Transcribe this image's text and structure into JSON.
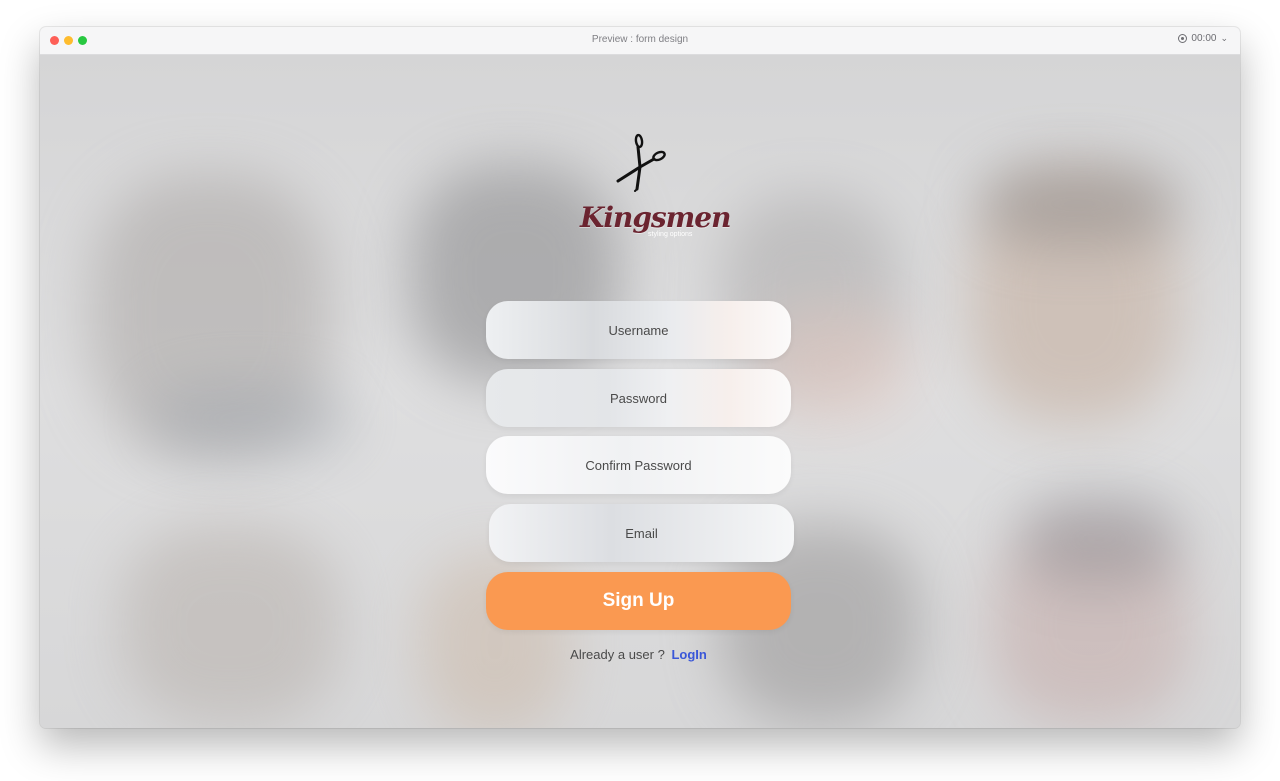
{
  "window": {
    "title": "Preview : form design",
    "timer": "00:00"
  },
  "brand": {
    "name": "Kingsmen",
    "tagline": "styling options",
    "color": "#6b2430"
  },
  "form": {
    "username_placeholder": "Username",
    "password_placeholder": "Password",
    "confirm_password_placeholder": "Confirm Password",
    "email_placeholder": "Email",
    "signup_label": "Sign Up",
    "already_user_text": "Already a user ?",
    "login_label": "LogIn"
  },
  "colors": {
    "accent": "#fa9951",
    "link": "#3a57d8"
  },
  "icons": {
    "logo": "scissors-icon",
    "record": "record-icon",
    "dropdown": "chevron-down-icon"
  }
}
